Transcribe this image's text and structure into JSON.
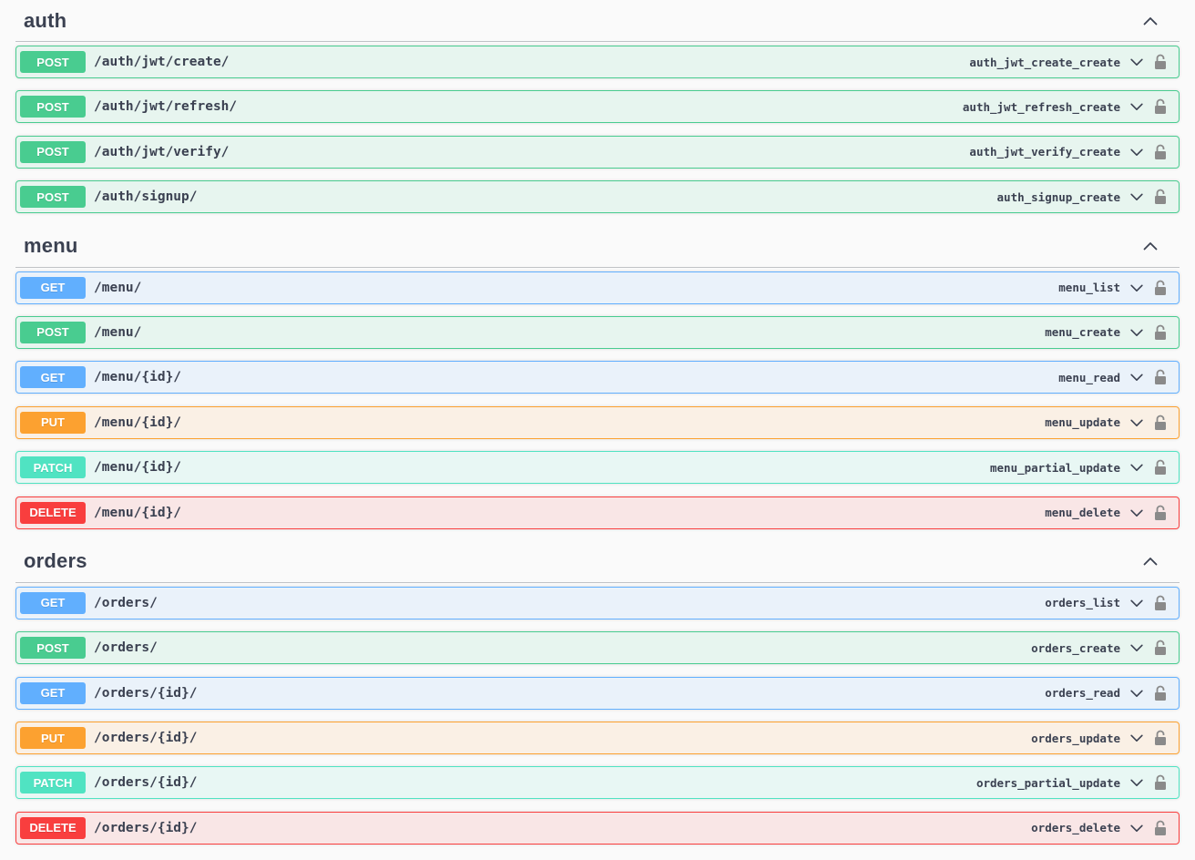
{
  "colors": {
    "post": "#49cc90",
    "get": "#61affe",
    "put": "#fca130",
    "patch": "#50e3c2",
    "delete": "#f93e3e",
    "text": "#3b4151"
  },
  "icons": {
    "collapse": "chevron-up-icon",
    "expand": "chevron-down-icon",
    "auth": "lock-icon"
  },
  "sections": [
    {
      "title": "auth",
      "operations": [
        {
          "method": "POST",
          "path": "/auth/jwt/create/",
          "operation_id": "auth_jwt_create_create"
        },
        {
          "method": "POST",
          "path": "/auth/jwt/refresh/",
          "operation_id": "auth_jwt_refresh_create"
        },
        {
          "method": "POST",
          "path": "/auth/jwt/verify/",
          "operation_id": "auth_jwt_verify_create"
        },
        {
          "method": "POST",
          "path": "/auth/signup/",
          "operation_id": "auth_signup_create"
        }
      ]
    },
    {
      "title": "menu",
      "operations": [
        {
          "method": "GET",
          "path": "/menu/",
          "operation_id": "menu_list"
        },
        {
          "method": "POST",
          "path": "/menu/",
          "operation_id": "menu_create"
        },
        {
          "method": "GET",
          "path": "/menu/{id}/",
          "operation_id": "menu_read"
        },
        {
          "method": "PUT",
          "path": "/menu/{id}/",
          "operation_id": "menu_update"
        },
        {
          "method": "PATCH",
          "path": "/menu/{id}/",
          "operation_id": "menu_partial_update"
        },
        {
          "method": "DELETE",
          "path": "/menu/{id}/",
          "operation_id": "menu_delete"
        }
      ]
    },
    {
      "title": "orders",
      "operations": [
        {
          "method": "GET",
          "path": "/orders/",
          "operation_id": "orders_list"
        },
        {
          "method": "POST",
          "path": "/orders/",
          "operation_id": "orders_create"
        },
        {
          "method": "GET",
          "path": "/orders/{id}/",
          "operation_id": "orders_read"
        },
        {
          "method": "PUT",
          "path": "/orders/{id}/",
          "operation_id": "orders_update"
        },
        {
          "method": "PATCH",
          "path": "/orders/{id}/",
          "operation_id": "orders_partial_update"
        },
        {
          "method": "DELETE",
          "path": "/orders/{id}/",
          "operation_id": "orders_delete"
        }
      ]
    }
  ]
}
